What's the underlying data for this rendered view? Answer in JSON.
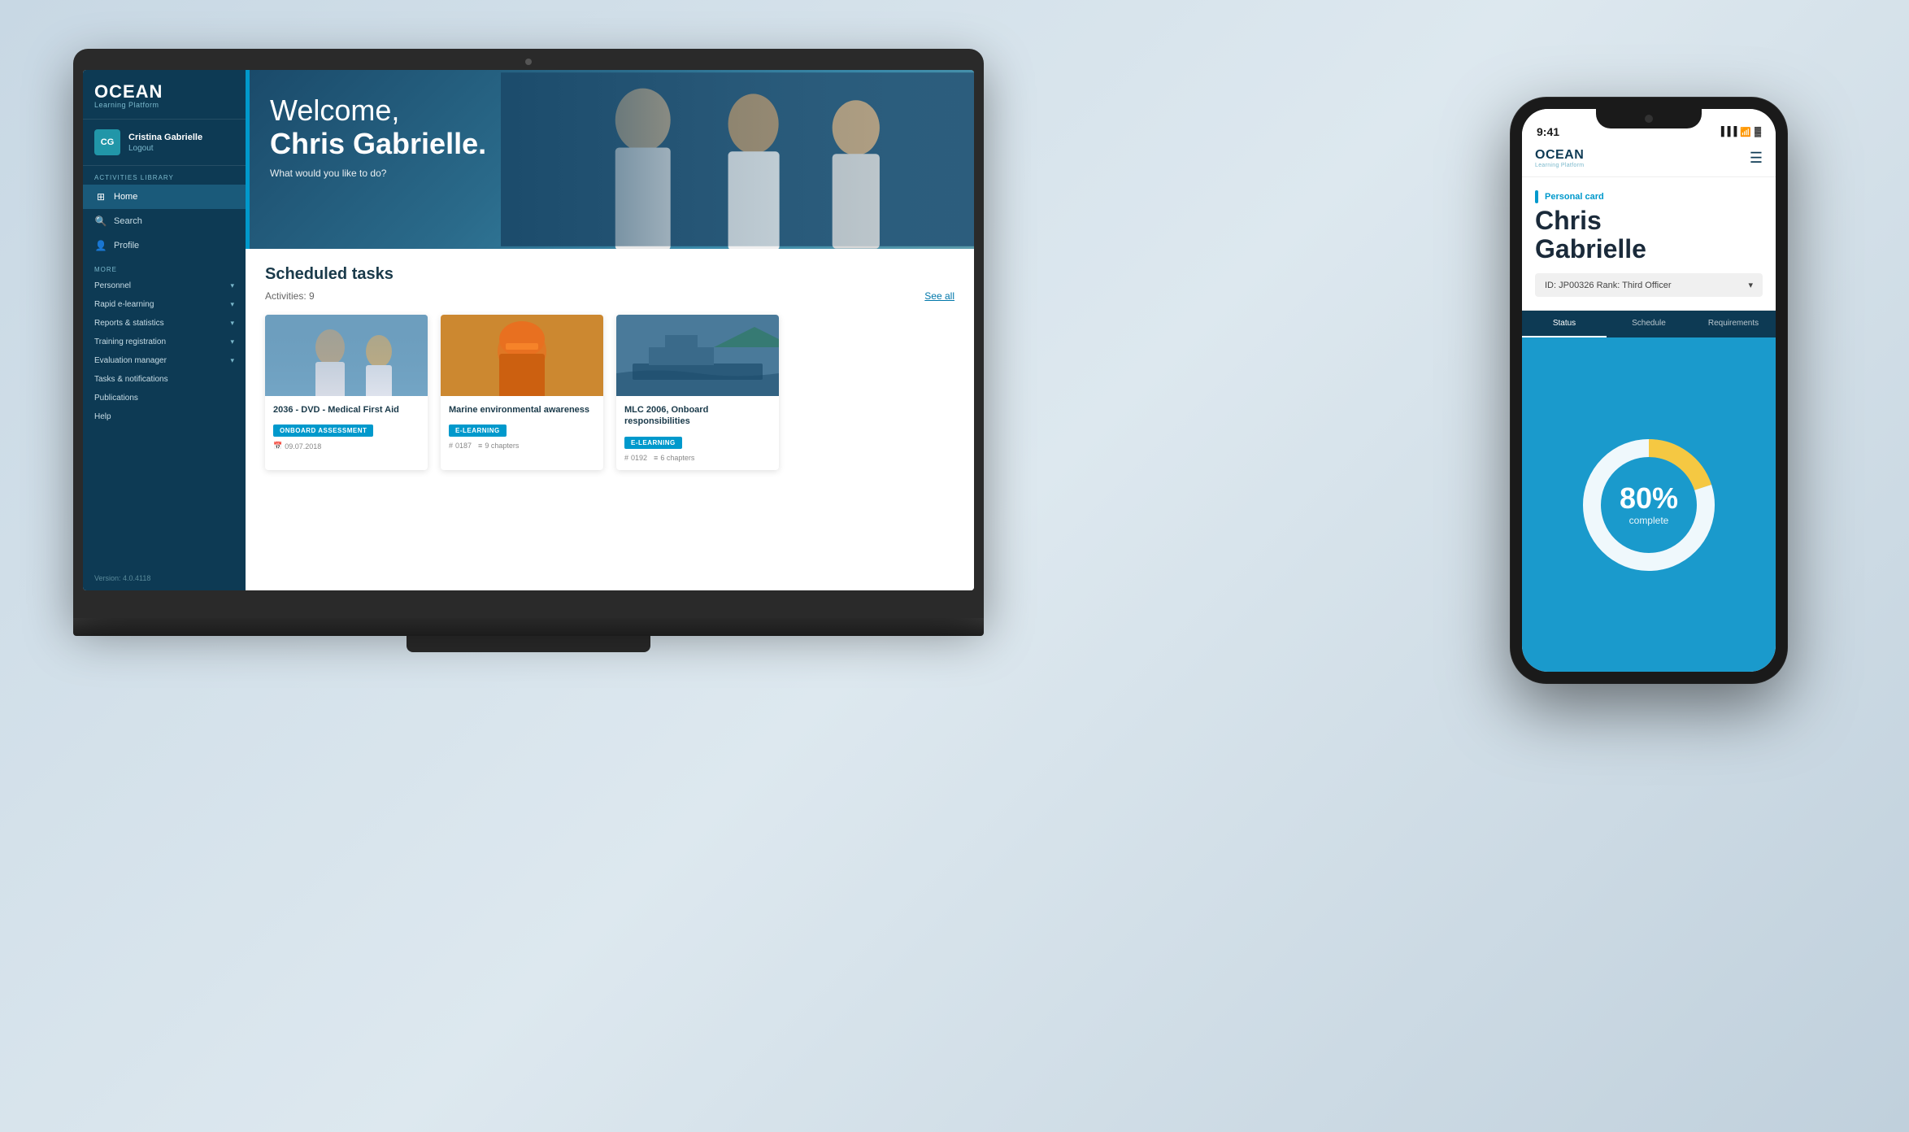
{
  "app": {
    "name": "OCEAN",
    "subtitle": "Learning Platform"
  },
  "laptop": {
    "sidebar": {
      "user": {
        "initials": "CG",
        "name": "Cristina Gabrielle",
        "logout": "Logout"
      },
      "activities_library_label": "ACTIVITIES LIBRARY",
      "nav_items": [
        {
          "id": "home",
          "label": "Home",
          "active": true
        },
        {
          "id": "search",
          "label": "Search",
          "active": false
        },
        {
          "id": "profile",
          "label": "Profile",
          "active": false
        }
      ],
      "more_label": "MORE",
      "more_items": [
        {
          "id": "personnel",
          "label": "Personnel",
          "has_chevron": true
        },
        {
          "id": "rapid-elearning",
          "label": "Rapid e-learning",
          "has_chevron": true
        },
        {
          "id": "reports",
          "label": "Reports & statistics",
          "has_chevron": true
        },
        {
          "id": "training",
          "label": "Training registration",
          "has_chevron": true
        },
        {
          "id": "evaluation",
          "label": "Evaluation manager",
          "has_chevron": true
        },
        {
          "id": "tasks",
          "label": "Tasks & notifications",
          "has_chevron": false
        },
        {
          "id": "publications",
          "label": "Publications",
          "has_chevron": false
        },
        {
          "id": "help",
          "label": "Help",
          "has_chevron": false
        }
      ],
      "version": "Version: 4.0.4118"
    },
    "hero": {
      "welcome": "Welcome,",
      "name": "Chris Gabrielle.",
      "subtitle": "What would you like to do?"
    },
    "scheduled_tasks": {
      "title": "Scheduled tasks",
      "activities_label": "Activities:",
      "activities_count": "9",
      "see_all": "See all",
      "cards": [
        {
          "title": "2036 - DVD - Medical First Aid",
          "badge": "ONBOARD ASSESSMENT",
          "badge_type": "onboard",
          "date": "09.07.2018",
          "img_type": "1"
        },
        {
          "title": "Marine environmental awareness",
          "badge": "E-LEARNING",
          "badge_type": "elearning",
          "id": "0187",
          "chapters": "9 chapters",
          "img_type": "2"
        },
        {
          "title": "MLC 2006, Onboard responsibilities",
          "badge": "E-LEARNING",
          "badge_type": "elearning",
          "id": "0192",
          "chapters": "6 chapters",
          "img_type": "3"
        }
      ]
    }
  },
  "phone": {
    "status_bar": {
      "time": "9:41",
      "signal": "▐▐▐",
      "wifi": "WiFi",
      "battery": "🔋"
    },
    "personal_card": {
      "label": "Personal card",
      "first_name": "Chris",
      "last_name": "Gabrielle",
      "id_rank": "ID: JP00326 Rank: Third Officer"
    },
    "tabs": [
      {
        "label": "Status",
        "active": true
      },
      {
        "label": "Schedule",
        "active": false
      },
      {
        "label": "Requirements",
        "active": false
      }
    ],
    "chart": {
      "percent": "80%",
      "label": "complete",
      "completed": 80,
      "remaining": 20
    }
  }
}
